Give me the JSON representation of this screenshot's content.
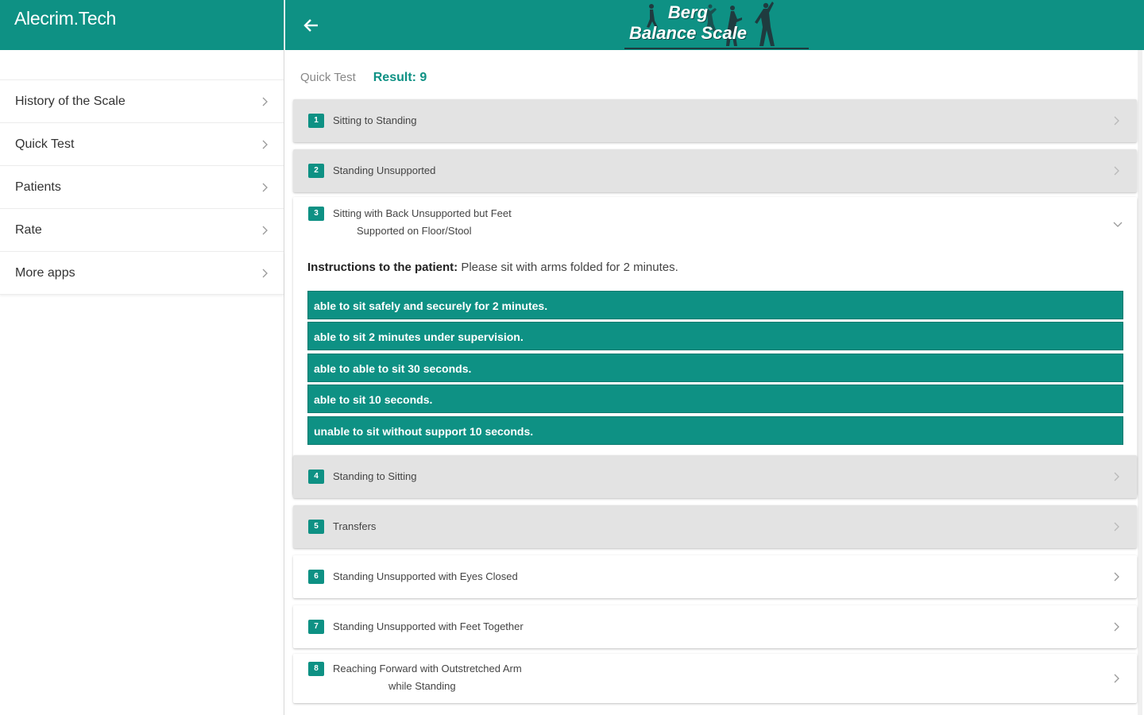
{
  "sidebar": {
    "title": "Alecrim.Tech",
    "items": [
      {
        "label": "History of the Scale"
      },
      {
        "label": "Quick Test"
      },
      {
        "label": "Patients"
      },
      {
        "label": "Rate"
      },
      {
        "label": "More apps"
      }
    ]
  },
  "header": {
    "logo_line1": "Berg",
    "logo_line2": "Balance Scale"
  },
  "main": {
    "breadcrumb": "Quick Test",
    "result": "Result: 9",
    "items": [
      {
        "number": "1",
        "title": "Sitting to Standing",
        "subtitle": ""
      },
      {
        "number": "2",
        "title": "Standing Unsupported",
        "subtitle": ""
      },
      {
        "number": "3",
        "title": "Sitting with Back Unsupported but Feet",
        "subtitle": "Supported on Floor/Stool"
      },
      {
        "number": "4",
        "title": "Standing to Sitting",
        "subtitle": ""
      },
      {
        "number": "5",
        "title": "Transfers",
        "subtitle": ""
      },
      {
        "number": "6",
        "title": "Standing Unsupported with Eyes Closed",
        "subtitle": ""
      },
      {
        "number": "7",
        "title": "Standing Unsupported with Feet Together",
        "subtitle": ""
      },
      {
        "number": "8",
        "title": "Reaching Forward with Outstretched Arm",
        "subtitle": "while Standing"
      }
    ],
    "expanded": {
      "instructions_label": "Instructions to the patient:",
      "instructions_text": " Please sit with arms folded for 2 minutes.",
      "options": [
        "able to sit safely and securely for 2 minutes.",
        "able to sit 2 minutes under supervision.",
        "able to able to sit 30 seconds.",
        "able to sit 10 seconds.",
        "unable to sit without support 10 seconds."
      ]
    }
  },
  "colors": {
    "accent": "#0e9184",
    "completed_card": "#e3e3e3"
  },
  "icons": {
    "back": "arrow-left-icon",
    "chevron": "chevron-right-icon",
    "expand": "chevron-down-icon"
  }
}
